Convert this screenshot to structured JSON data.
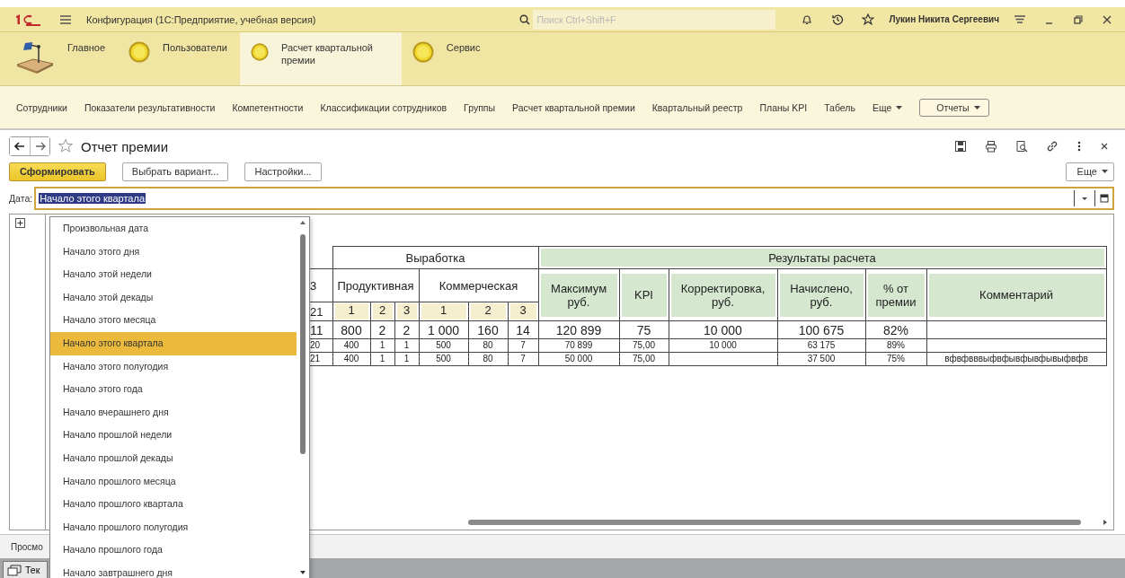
{
  "titlebar": {
    "title": "Конфигурация  (1С:Предприятие, учебная версия)",
    "search": {
      "placeholder": "Поиск Ctrl+Shift+F"
    },
    "user": "Лукин Никита Сергеевич"
  },
  "sections": [
    {
      "label": "Главное",
      "kind": "home",
      "selected": false
    },
    {
      "label": "Пользователи",
      "kind": "default",
      "selected": false
    },
    {
      "label": "Расчет квартальной премии",
      "kind": "default",
      "selected": true
    },
    {
      "label": "Сервис",
      "kind": "default",
      "selected": false
    }
  ],
  "nav": {
    "links": [
      "Сотрудники",
      "Показатели результативности",
      "Компетентности",
      "Классификации сотрудников",
      "Группы",
      "Расчет квартальной премии",
      "Квартальный реестр",
      "Планы KPI",
      "Табель"
    ],
    "more": "Еще",
    "reports": "Отчеты"
  },
  "form": {
    "title": "Отчет премии",
    "buttons": [
      {
        "label": "Сформировать",
        "kind": "primary"
      },
      {
        "label": "Выбрать вариант...",
        "kind": "plain"
      },
      {
        "label": "Настройки...",
        "kind": "plain"
      }
    ],
    "more": "Еще",
    "date": {
      "label": "Дата:",
      "value": "Начало этого квартала"
    }
  },
  "dropdown": {
    "items": [
      {
        "label": "Произвольная дата",
        "selected": false
      },
      {
        "label": "Начало этого дня",
        "selected": false
      },
      {
        "label": "Начало этой недели",
        "selected": false
      },
      {
        "label": "Начало этой декады",
        "selected": false
      },
      {
        "label": "Начало этого месяца",
        "selected": false
      },
      {
        "label": "Начало этого квартала",
        "selected": true
      },
      {
        "label": "Начало этого полугодия",
        "selected": false
      },
      {
        "label": "Начало этого года",
        "selected": false
      },
      {
        "label": "Начало вчерашнего дня",
        "selected": false
      },
      {
        "label": "Начало прошлой недели",
        "selected": false
      },
      {
        "label": "Начало прошлой декады",
        "selected": false
      },
      {
        "label": "Начало прошлого месяца",
        "selected": false
      },
      {
        "label": "Начало прошлого квартала",
        "selected": false
      },
      {
        "label": "Начало прошлого полугодия",
        "selected": false
      },
      {
        "label": "Начало прошлого года",
        "selected": false
      },
      {
        "label": "Начало завтрашнего дня",
        "selected": false
      }
    ]
  },
  "report_table": {
    "cut_column": {
      "header": "3",
      "subheader": "21"
    },
    "output": {
      "title": "Выработка",
      "groups": [
        {
          "title": "Продуктивная",
          "subcolumns": [
            "1",
            "2",
            "3"
          ]
        },
        {
          "title": "Коммерческая",
          "subcolumns": [
            "1",
            "2",
            "3"
          ]
        }
      ]
    },
    "results": {
      "title": "Результаты расчета",
      "columns": [
        "Максимум руб.",
        "KPI",
        "Корректировка, руб.",
        "Начислено, руб.",
        "% от премии",
        "Комментарий"
      ]
    },
    "rows": [
      {
        "kind": "total",
        "cells": [
          "11",
          "800",
          "2",
          "2",
          "1 000",
          "160",
          "14",
          "120 899",
          "75",
          "10 000",
          "100 675",
          "82%"
        ]
      },
      {
        "kind": "detail",
        "cells": [
          "20",
          "400",
          "1",
          "1",
          "500",
          "80",
          "7",
          "70 899",
          "75,00",
          "10 000",
          "63 175",
          "89%"
        ]
      },
      {
        "kind": "detail",
        "cells": [
          "21",
          "400",
          "1",
          "1",
          "500",
          "80",
          "7",
          "50 000",
          "75,00",
          null,
          "37 500",
          "75%"
        ],
        "comment": "вфвфвввыфвфывфывфывыфвфв"
      }
    ]
  },
  "bottom": {
    "label": "Просмо",
    "tab": "Тек"
  }
}
